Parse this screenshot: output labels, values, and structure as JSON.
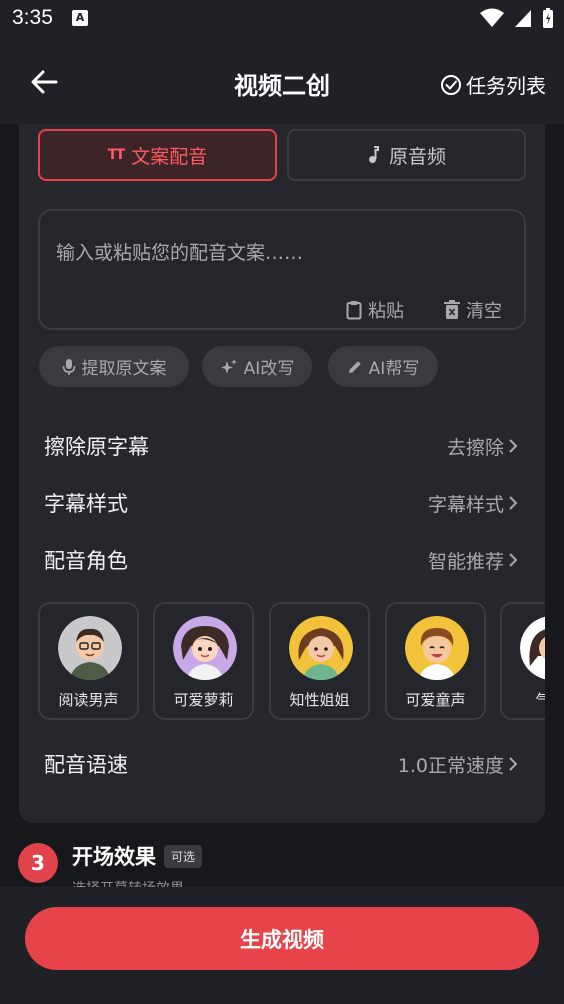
{
  "status": {
    "time": "3:35"
  },
  "header": {
    "title": "视频二创",
    "tasks_label": "任务列表"
  },
  "tabs": {
    "dub": "文案配音",
    "audio": "原音频",
    "dub_icon_text": "TT"
  },
  "input": {
    "placeholder": "输入或粘贴您的配音文案……",
    "paste": "粘贴",
    "clear": "清空"
  },
  "chips": {
    "extract": "提取原文案",
    "rewrite": "AI改写",
    "write": "AI帮写"
  },
  "settings": {
    "erase": {
      "label": "擦除原字幕",
      "value": "去擦除"
    },
    "style": {
      "label": "字幕样式",
      "value": "字幕样式"
    },
    "voice": {
      "label": "配音角色",
      "value": "智能推荐"
    },
    "speed": {
      "label": "配音语速",
      "value": "1.0正常速度"
    }
  },
  "voices": [
    {
      "name": "阅读男声",
      "bg": "#c9c9cc"
    },
    {
      "name": "可爱萝莉",
      "bg": "#c8a8e6"
    },
    {
      "name": "知性姐姐",
      "bg": "#f2c23a"
    },
    {
      "name": "可爱童声",
      "bg": "#f2c23a"
    },
    {
      "name": "气质",
      "bg": "#ffffff"
    }
  ],
  "step3": {
    "number": "3",
    "title": "开场效果",
    "badge": "可选",
    "subtitle": "选择开幕转场效果"
  },
  "generate": {
    "label": "生成视频"
  },
  "colors": {
    "accent": "#e6434a",
    "background": "#17181c",
    "card": "#26272d"
  }
}
